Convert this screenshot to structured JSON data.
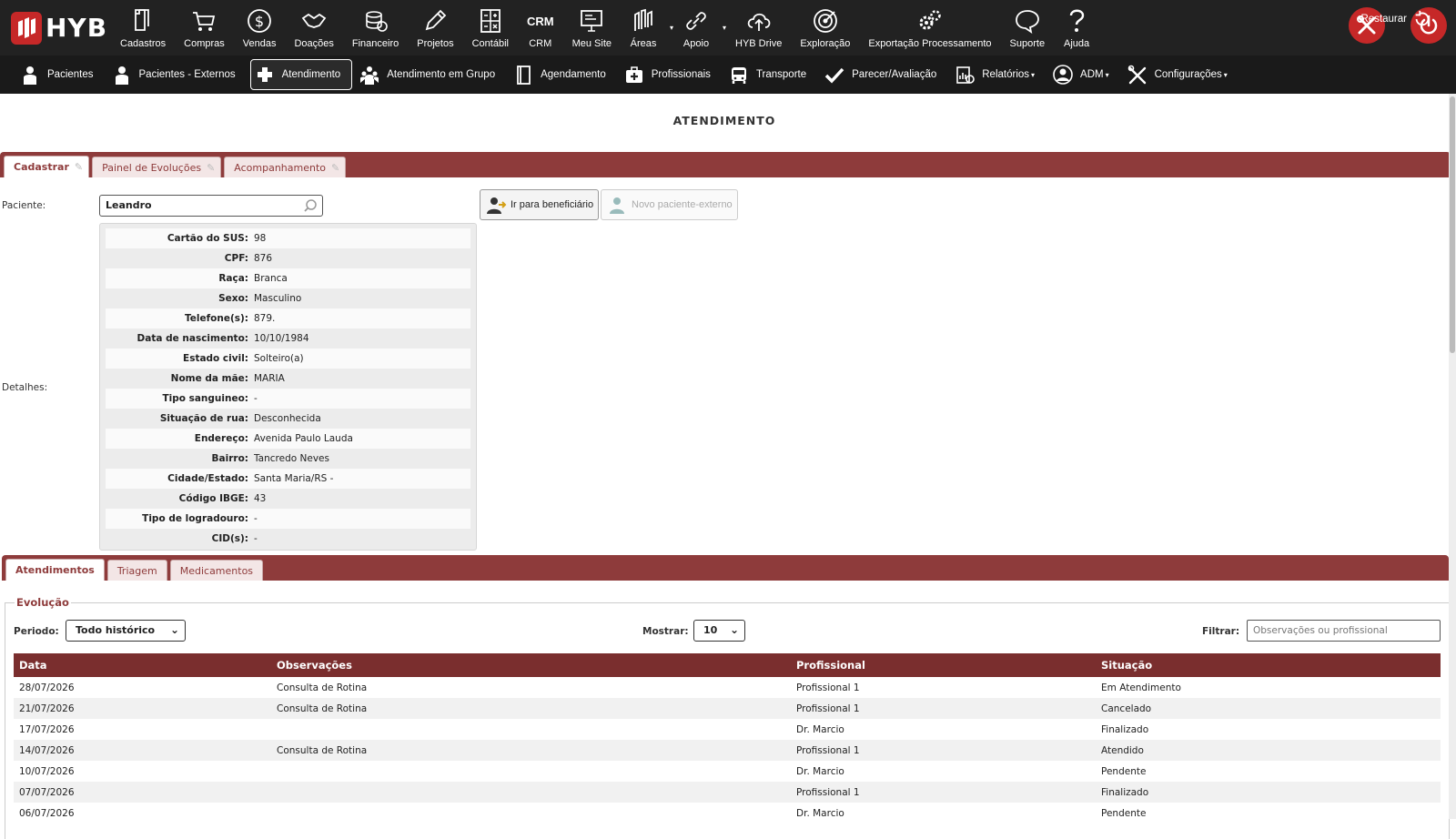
{
  "brand": {
    "logo_text": "HYB"
  },
  "topmenu": [
    {
      "label": "Cadastros",
      "icon": "file-icon"
    },
    {
      "label": "Compras",
      "icon": "cart-icon"
    },
    {
      "label": "Vendas",
      "icon": "dollar-icon"
    },
    {
      "label": "Doações",
      "icon": "handshake-icon"
    },
    {
      "label": "Financeiro",
      "icon": "coins-icon"
    },
    {
      "label": "Projetos",
      "icon": "pencil-icon"
    },
    {
      "label": "Contábil",
      "icon": "calculator-icon"
    },
    {
      "label": "CRM",
      "icon": "crm-icon"
    },
    {
      "label": "Meu Site",
      "icon": "monitor-icon"
    },
    {
      "label": "Áreas",
      "icon": "areas-icon"
    },
    {
      "label": "Apoio",
      "icon": "link-icon"
    },
    {
      "label": "HYB Drive",
      "icon": "cloud-upload-icon"
    },
    {
      "label": "Exploração",
      "icon": "target-icon"
    },
    {
      "label": "Exportação Processamento",
      "icon": "gears-icon"
    },
    {
      "label": "Suporte",
      "icon": "chat-icon"
    },
    {
      "label": "Ajuda",
      "icon": "question-icon"
    }
  ],
  "crm_glyph": "CRM",
  "navbar": [
    {
      "label": "Pacientes",
      "icon": "person-icon"
    },
    {
      "label": "Pacientes - Externos",
      "icon": "person-icon"
    },
    {
      "label": "Atendimento",
      "icon": "medical-cross-icon",
      "active": true
    },
    {
      "label": "Atendimento em Grupo",
      "icon": "group-icon"
    },
    {
      "label": "Agendamento",
      "icon": "book-icon"
    },
    {
      "label": "Profissionais",
      "icon": "medkit-icon"
    },
    {
      "label": "Transporte",
      "icon": "bus-icon"
    },
    {
      "label": "Parecer/Avaliação",
      "icon": "check-icon"
    },
    {
      "label": "Relatórios",
      "icon": "report-icon",
      "caret": true
    },
    {
      "label": "ADM",
      "icon": "user-circle-icon",
      "caret": true
    },
    {
      "label": "Configurações",
      "icon": "tools-icon",
      "caret": true
    }
  ],
  "restore_label": "Restaurar",
  "page_title": "ATENDIMENTO",
  "tabs": [
    "Cadastrar",
    "Painel de Evoluções",
    "Acompanhamento"
  ],
  "form": {
    "patient_label": "Paciente:",
    "patient_value": "Leandro",
    "details_label": "Detalhes:",
    "goto_button": "Ir para beneficiário",
    "new_external_button": "Novo paciente-externo"
  },
  "details": [
    {
      "key": "Cartão do SUS:",
      "value": "98"
    },
    {
      "key": "CPF:",
      "value": "876"
    },
    {
      "key": "Raça:",
      "value": "Branca"
    },
    {
      "key": "Sexo:",
      "value": "Masculino"
    },
    {
      "key": "Telefone(s):",
      "value": "879."
    },
    {
      "key": "Data de nascimento:",
      "value": "10/10/1984"
    },
    {
      "key": "Estado civil:",
      "value": "Solteiro(a)"
    },
    {
      "key": "Nome da mãe:",
      "value": "MARIA"
    },
    {
      "key": "Tipo sanguineo:",
      "value": "-"
    },
    {
      "key": "Situação de rua:",
      "value": "Desconhecida"
    },
    {
      "key": "Endereço:",
      "value": "Avenida Paulo Lauda"
    },
    {
      "key": "Bairro:",
      "value": "Tancredo Neves"
    },
    {
      "key": "Cidade/Estado:",
      "value": "Santa Maria/RS -"
    },
    {
      "key": "Código IBGE:",
      "value": "43"
    },
    {
      "key": "Tipo de logradouro:",
      "value": "-"
    },
    {
      "key": "CID(s):",
      "value": "-"
    }
  ],
  "tabs2": [
    "Atendimentos",
    "Triagem",
    "Medicamentos"
  ],
  "evolucao": {
    "legend": "Evolução",
    "period_label": "Periodo:",
    "period_value": "Todo histórico",
    "show_label": "Mostrar:",
    "show_value": "10",
    "filter_label": "Filtrar:",
    "filter_placeholder": "Observações ou profissional"
  },
  "table": {
    "headers": [
      "Data",
      "Observações",
      "Profissional",
      "Situação"
    ],
    "rows": [
      [
        "28/07/2026",
        "Consulta de Rotina",
        "Profissional 1",
        "Em Atendimento"
      ],
      [
        "21/07/2026",
        "Consulta de Rotina",
        "Profissional 1",
        "Cancelado"
      ],
      [
        "17/07/2026",
        "",
        "Dr. Marcio",
        "Finalizado"
      ],
      [
        "14/07/2026",
        "Consulta de Rotina",
        "Profissional 1",
        "Atendido"
      ],
      [
        "10/07/2026",
        "",
        "Dr. Marcio",
        "Pendente"
      ],
      [
        "07/07/2026",
        "",
        "Profissional 1",
        "Finalizado"
      ],
      [
        "06/07/2026",
        "",
        "Dr. Marcio",
        "Pendente"
      ]
    ]
  },
  "colors": {
    "brand_red": "#c62828",
    "tab_bar": "#8e3b3b",
    "table_header": "#7a2e2e",
    "topbar": "#222222"
  }
}
